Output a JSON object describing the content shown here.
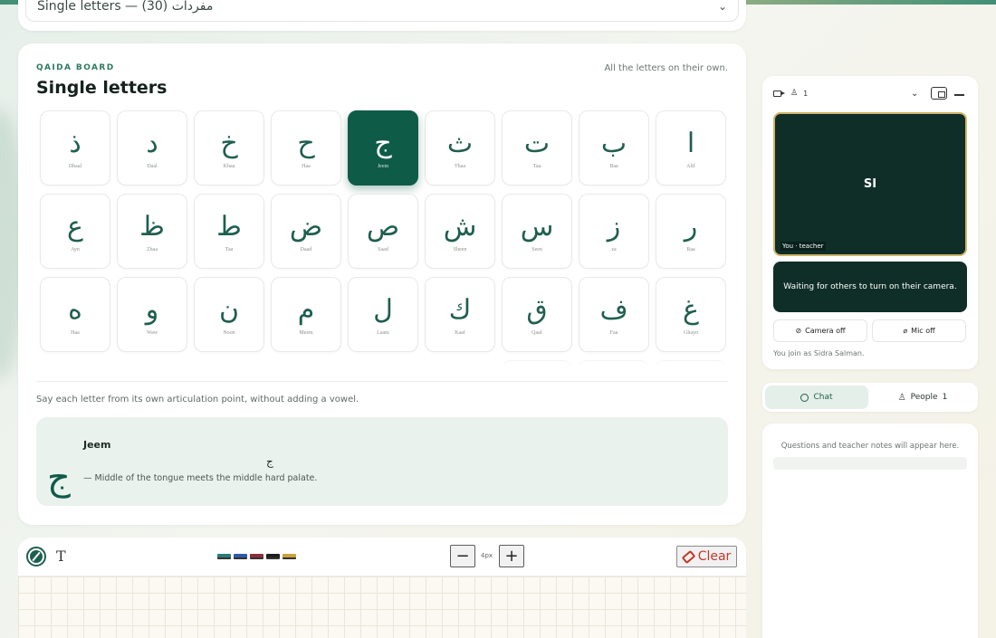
{
  "lesson_select": {
    "value": "Single letters — (30) مفردات"
  },
  "board": {
    "eyebrow": "QAIDA BOARD",
    "title": "Single letters",
    "note": "All the letters on their own.",
    "letters": [
      {
        "glyph": "ا",
        "name": "Alif"
      },
      {
        "glyph": "ب",
        "name": "Baa"
      },
      {
        "glyph": "ت",
        "name": "Taa"
      },
      {
        "glyph": "ث",
        "name": "Thaa"
      },
      {
        "glyph": "ج",
        "name": "Jeem",
        "active": true
      },
      {
        "glyph": "ح",
        "name": "Haa"
      },
      {
        "glyph": "خ",
        "name": "Khaa"
      },
      {
        "glyph": "د",
        "name": "Daal"
      },
      {
        "glyph": "ذ",
        "name": "Dhaal"
      },
      {
        "glyph": "ر",
        "name": "Raa"
      },
      {
        "glyph": "ز",
        "name": "za"
      },
      {
        "glyph": "س",
        "name": "Seen"
      },
      {
        "glyph": "ش",
        "name": "Sheen"
      },
      {
        "glyph": "ص",
        "name": "Saad"
      },
      {
        "glyph": "ض",
        "name": "Daad"
      },
      {
        "glyph": "ط",
        "name": "Taa"
      },
      {
        "glyph": "ظ",
        "name": "Zhaa"
      },
      {
        "glyph": "ع",
        "name": "Ayn"
      },
      {
        "glyph": "غ",
        "name": "Ghayn"
      },
      {
        "glyph": "ف",
        "name": "Faa"
      },
      {
        "glyph": "ق",
        "name": "Qaaf"
      },
      {
        "glyph": "ك",
        "name": "Kaaf"
      },
      {
        "glyph": "ل",
        "name": "Laam"
      },
      {
        "glyph": "م",
        "name": "Meem"
      },
      {
        "glyph": "ن",
        "name": "Noon"
      },
      {
        "glyph": "و",
        "name": "Waw"
      },
      {
        "glyph": "ه",
        "name": "Haa"
      }
    ],
    "hint": "Say each letter from its own articulation point, without adding a vowel.",
    "detail": {
      "glyph": "ج",
      "name": "Jeem",
      "small_glyph": "ج",
      "description": "— Middle of the tongue meets the middle hard palate."
    }
  },
  "drawing": {
    "text_tool": "T",
    "swatches": [
      "#2f7a78",
      "#2f5aa8",
      "#8a2f3c",
      "#1e1e1e",
      "#c9a23a"
    ],
    "stroke_size": "4px",
    "minus_label": "−",
    "plus_label": "+",
    "clear_label": "Clear"
  },
  "video": {
    "participant_count": "1",
    "initials": "SI",
    "tile_label": "You · teacher",
    "waiting_text": "Waiting for others to turn on their camera.",
    "camera_btn": "Camera off",
    "mic_btn": "Mic off",
    "join_note": "You join as Sidra Salman."
  },
  "tabs": {
    "chat_label": "Chat",
    "people_label": "People",
    "people_count": "1"
  },
  "chat": {
    "empty_text": "Questions and teacher notes will appear here."
  }
}
